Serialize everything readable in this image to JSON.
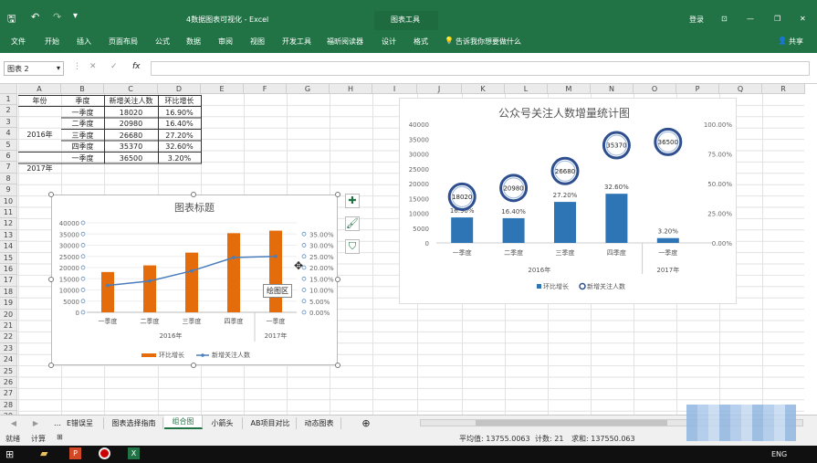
{
  "window": {
    "title": "4数据图表可视化 - Excel",
    "context_tab": "图表工具",
    "user": "登录",
    "controls": [
      "⊡",
      "—",
      "❐",
      "✕"
    ],
    "share": "共享"
  },
  "qat": {
    "save": "🖫",
    "undo": "↶",
    "redo": "↷"
  },
  "menu": [
    "文件",
    "开始",
    "插入",
    "页面布局",
    "公式",
    "数据",
    "审阅",
    "视图",
    "开发工具",
    "福昕阅读器",
    "设计",
    "格式"
  ],
  "tellme": "告诉我你想要做什么",
  "formula": {
    "namebox": "图表 2",
    "fx": "fx"
  },
  "columns": [
    "A",
    "B",
    "C",
    "D",
    "E",
    "F",
    "G",
    "H",
    "I",
    "J",
    "K",
    "L",
    "M",
    "N",
    "O",
    "P",
    "Q",
    "R"
  ],
  "rows": [
    "1",
    "2",
    "3",
    "4",
    "5",
    "6",
    "7",
    "8",
    "9",
    "10",
    "11",
    "12",
    "13",
    "14",
    "15",
    "16",
    "17",
    "18",
    "19",
    "20",
    "21",
    "22",
    "23",
    "24",
    "25",
    "26",
    "27",
    "28",
    "29"
  ],
  "table": {
    "headers": [
      "年份",
      "季度",
      "新增关注人数",
      "环比增长"
    ],
    "year1": "2016年",
    "year2": "2017年",
    "rows": [
      [
        "一季度",
        "18020",
        "16.90%"
      ],
      [
        "二季度",
        "20980",
        "16.40%"
      ],
      [
        "三季度",
        "26680",
        "27.20%"
      ],
      [
        "四季度",
        "35370",
        "32.60%"
      ],
      [
        "一季度",
        "36500",
        "3.20%"
      ]
    ]
  },
  "chart_left": {
    "title": "图表标题",
    "tooltip": "绘图区",
    "type": "bar+line",
    "categories": [
      "一季度",
      "二季度",
      "三季度",
      "四季度",
      "一季度"
    ],
    "groups": [
      "2016年",
      "2017年"
    ],
    "y_ticks": [
      "40000",
      "35000",
      "30000",
      "25000",
      "20000",
      "15000",
      "10000",
      "5000",
      "0"
    ],
    "y2_ticks": [
      "35.00%",
      "30.00%",
      "25.00%",
      "20.00%",
      "15.00%",
      "10.00%",
      "5.00%",
      "0.00%"
    ],
    "legend": [
      "环比增长",
      "新增关注人数"
    ],
    "colors": {
      "bar": "#e46c0a",
      "line": "#4a7ebb"
    }
  },
  "chart_right": {
    "title": "公众号关注人数增量统计图",
    "y_ticks": [
      "40000",
      "35000",
      "30000",
      "25000",
      "20000",
      "15000",
      "10000",
      "5000",
      "0"
    ],
    "y2_ticks": [
      "100.00%",
      "75.00%",
      "50.00%",
      "25.00%",
      "0.00%"
    ],
    "categories": [
      "一季度",
      "二季度",
      "三季度",
      "四季度",
      "一季度"
    ],
    "groups": [
      "2016年",
      "2017年"
    ],
    "bubble_labels": [
      "18020",
      "20980",
      "26680",
      "35370",
      "36500"
    ],
    "bar_labels": [
      "16.90%",
      "16.40%",
      "27.20%",
      "32.60%",
      "3.20%"
    ],
    "legend": [
      "环比增长",
      "新增关注人数"
    ],
    "colors": {
      "bar": "#2e75b6",
      "circle": "#2f4f8f"
    }
  },
  "chart_data": [
    {
      "type": "bar",
      "title": "图表标题",
      "categories": [
        "一季度",
        "二季度",
        "三季度",
        "四季度",
        "一季度"
      ],
      "series": [
        {
          "name": "环比增长",
          "values": [
            0.169,
            0.164,
            0.272,
            0.326,
            0.032
          ]
        },
        {
          "name": "新增关注人数",
          "values": [
            18020,
            20980,
            26680,
            35370,
            36500
          ]
        }
      ],
      "ylim": [
        0,
        40000
      ],
      "y2lim": [
        0,
        0.35
      ]
    },
    {
      "type": "bar",
      "title": "公众号关注人数增量统计图",
      "categories": [
        "一季度",
        "二季度",
        "三季度",
        "四季度",
        "一季度"
      ],
      "series": [
        {
          "name": "环比增长",
          "values": [
            0.169,
            0.164,
            0.272,
            0.326,
            0.032
          ]
        },
        {
          "name": "新增关注人数",
          "values": [
            18020,
            20980,
            26680,
            35370,
            36500
          ]
        }
      ],
      "ylim": [
        0,
        40000
      ],
      "y2lim": [
        0,
        1.0
      ]
    }
  ],
  "sheets": [
    "E错误呈",
    "图表选择指南",
    "组合图",
    "小箭头",
    "AB项目对比",
    "动态图表"
  ],
  "active_sheet": "组合图",
  "status": {
    "mode": "就绪",
    "calc": "计算",
    "avg": "平均值: 13755.0063",
    "count": "计数: 21",
    "sum": "求和: 137550.063"
  },
  "taskbar": {
    "lang": "ENG"
  }
}
